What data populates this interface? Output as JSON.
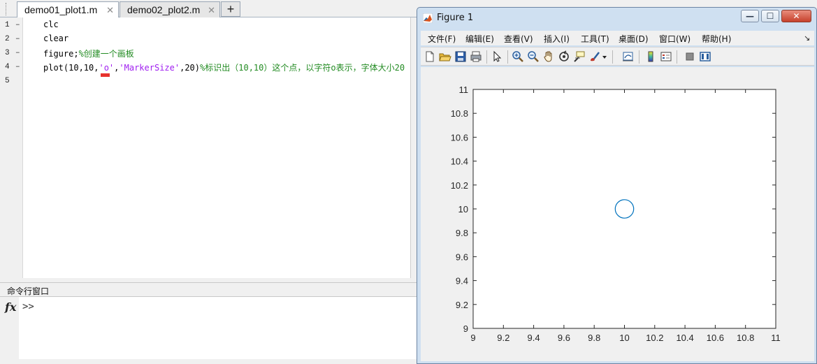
{
  "editor": {
    "tabs": [
      {
        "label": "demo01_plot1.m",
        "close": "✕",
        "active": true
      },
      {
        "label": "demo02_plot2.m",
        "close": "✕",
        "active": false
      }
    ],
    "add_tab": "+",
    "line_numbers": [
      "1",
      "2",
      "3",
      "4",
      "5"
    ],
    "line_marks": [
      "–",
      "–",
      "–",
      "–",
      ""
    ],
    "code": {
      "l1": "clc",
      "l2": "clear",
      "l3_code": "figure;",
      "l3_comment": "%创建一个画板",
      "l4_a": "plot(10,10,",
      "l4_s1": "'o'",
      "l4_b": ",",
      "l4_s2": "'MarkerSize'",
      "l4_c": ",20)",
      "l4_comment": "%标识出（10,10）这个点，以字符o表示，字体大小20"
    }
  },
  "command_window": {
    "title": "命令行窗口",
    "fx": "fx",
    "prompt": ">>"
  },
  "figure": {
    "title": "Figure 1",
    "window_buttons": {
      "minimize": "—",
      "maximize": "☐",
      "close": "✕"
    },
    "menu": [
      "文件(F)",
      "编辑(E)",
      "查看(V)",
      "插入(I)",
      "工具(T)",
      "桌面(D)",
      "窗口(W)",
      "帮助(H)"
    ],
    "menu_overflow": "↘"
  },
  "chart_data": {
    "type": "scatter",
    "title": "",
    "xlabel": "",
    "ylabel": "",
    "xlim": [
      9,
      11
    ],
    "ylim": [
      9,
      11
    ],
    "x_ticks": [
      "9",
      "9.2",
      "9.4",
      "9.6",
      "9.8",
      "10",
      "10.2",
      "10.4",
      "10.6",
      "10.8",
      "11"
    ],
    "y_ticks": [
      "9",
      "9.2",
      "9.4",
      "9.6",
      "9.8",
      "10",
      "10.2",
      "10.4",
      "10.6",
      "10.8",
      "11"
    ],
    "series": [
      {
        "x": [
          10
        ],
        "y": [
          10
        ],
        "marker": "o",
        "marker_size": 20,
        "color": "#0072bd"
      }
    ],
    "grid": false
  }
}
